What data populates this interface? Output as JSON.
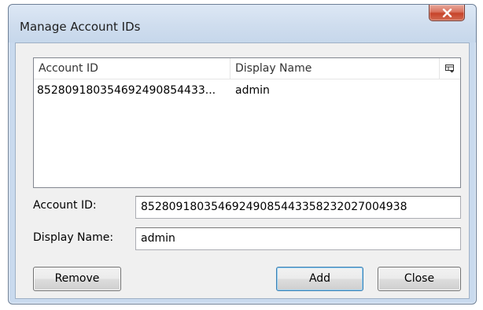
{
  "window": {
    "title": "Manage Account IDs"
  },
  "list": {
    "columns": [
      "Account ID",
      "Display Name"
    ],
    "rows": [
      {
        "account_id": "852809180354692490854433...",
        "display_name": "admin"
      }
    ]
  },
  "form": {
    "account_id_label": "Account ID:",
    "account_id_value": "85280918035469249085443358232027004938",
    "display_name_label": "Display Name:",
    "display_name_value": "admin"
  },
  "buttons": {
    "remove": "Remove",
    "add": "Add",
    "close": "Close"
  }
}
